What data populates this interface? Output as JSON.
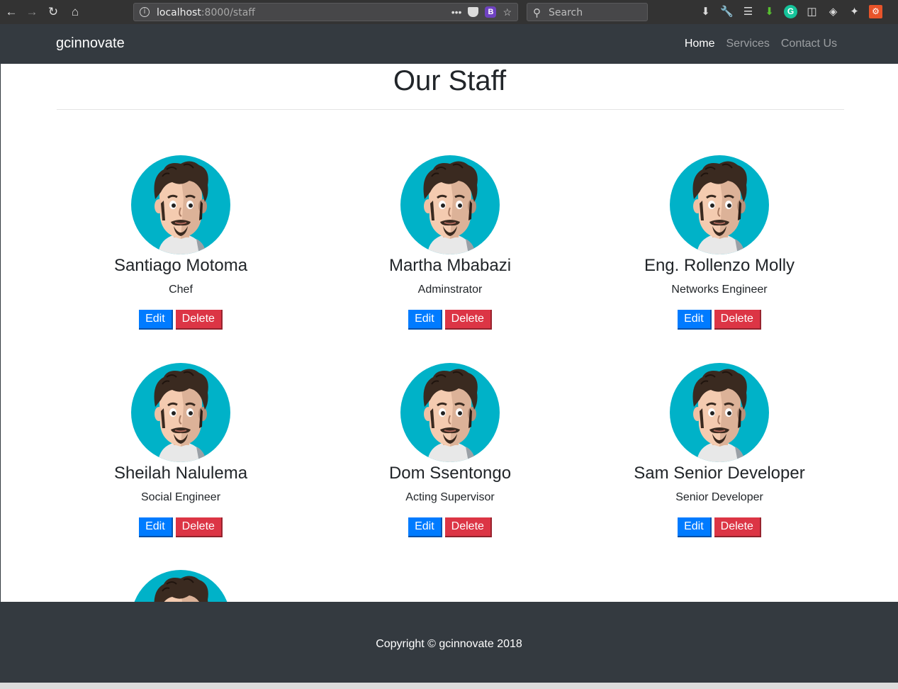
{
  "browser": {
    "url_host": "localhost",
    "url_rest": ":8000/staff",
    "search_placeholder": "Search",
    "bootstrap_badge": "B"
  },
  "navbar": {
    "brand": "gcinnovate",
    "links": [
      {
        "label": "Home",
        "active": true
      },
      {
        "label": "Services",
        "active": false
      },
      {
        "label": "Contact Us",
        "active": false
      }
    ]
  },
  "page": {
    "title": "Our Staff"
  },
  "staff": [
    {
      "name": "Santiago Motoma",
      "role": "Chef",
      "edit_label": "Edit",
      "delete_label": "Delete"
    },
    {
      "name": "Martha Mbabazi",
      "role": "Adminstrator",
      "edit_label": "Edit",
      "delete_label": "Delete"
    },
    {
      "name": "Eng. Rollenzo Molly",
      "role": "Networks Engineer",
      "edit_label": "Edit",
      "delete_label": "Delete"
    },
    {
      "name": "Sheilah Nalulema",
      "role": "Social Engineer",
      "edit_label": "Edit",
      "delete_label": "Delete"
    },
    {
      "name": "Dom Ssentongo",
      "role": "Acting Supervisor",
      "edit_label": "Edit",
      "delete_label": "Delete"
    },
    {
      "name": "Sam Senior Developer",
      "role": "Senior Developer",
      "edit_label": "Edit",
      "delete_label": "Delete"
    }
  ],
  "footer": {
    "copyright": "Copyright © gcinnovate 2018"
  },
  "colors": {
    "navbar_bg": "#343a40",
    "avatar_bg": "#00b2c8",
    "edit_button": "#007bff",
    "delete_button": "#dc3545"
  }
}
